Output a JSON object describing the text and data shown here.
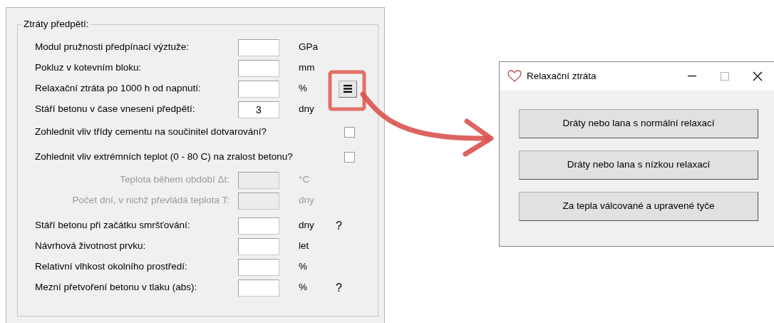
{
  "group": {
    "title": "Ztráty předpětí:"
  },
  "rows": [
    {
      "kind": "field",
      "label": "Modul pružnosti předpínací výztuže:",
      "value": "",
      "unit": "GPa",
      "disabled": false
    },
    {
      "kind": "field",
      "label": "Pokluz v kotevním bloku:",
      "value": "",
      "unit": "mm",
      "disabled": false
    },
    {
      "kind": "field",
      "label": "Relaxační ztráta po 1000 h od napnutí:",
      "value": "",
      "unit": "%",
      "disabled": false,
      "menu_button": true
    },
    {
      "kind": "field",
      "label": "Stáří betonu v čase vnesení předpětí:",
      "value": "3",
      "unit": "dny",
      "disabled": false
    },
    {
      "kind": "checkbox",
      "label": "Zohlednit vliv třídy cementu na součinitel dotvarování?",
      "checked": false
    },
    {
      "kind": "checkbox",
      "label": "Zohlednit vliv extrémních teplot (0 - 80 C) na zralost betonu?",
      "checked": false
    },
    {
      "kind": "field",
      "label": "Teplota během období Δt:",
      "value": "",
      "unit": "°C",
      "disabled": true
    },
    {
      "kind": "field",
      "label": "Počet dní, v nichž převládá teplota T:",
      "value": "",
      "unit": "dny",
      "disabled": true
    },
    {
      "kind": "field",
      "label": "Stáří betonu při začátku smršťování:",
      "value": "",
      "unit": "dny",
      "disabled": false,
      "help": "?"
    },
    {
      "kind": "field",
      "label": "Návrhová životnost prvku:",
      "value": "",
      "unit": "let",
      "disabled": false
    },
    {
      "kind": "field",
      "label": "Relativní vlhkost okolního prostředí:",
      "value": "",
      "unit": "%",
      "disabled": false
    },
    {
      "kind": "field",
      "label": "Mezní přetvoření betonu v tlaku (abs):",
      "value": "",
      "unit": "%",
      "disabled": false,
      "help": "?"
    }
  ],
  "dialog": {
    "title": "Relaxační ztráta",
    "buttons": [
      "Dráty nebo lana s normální relaxací",
      "Dráty nebo lana s nízkou relaxací",
      "Za tepla válcované a upravené tyče"
    ]
  }
}
